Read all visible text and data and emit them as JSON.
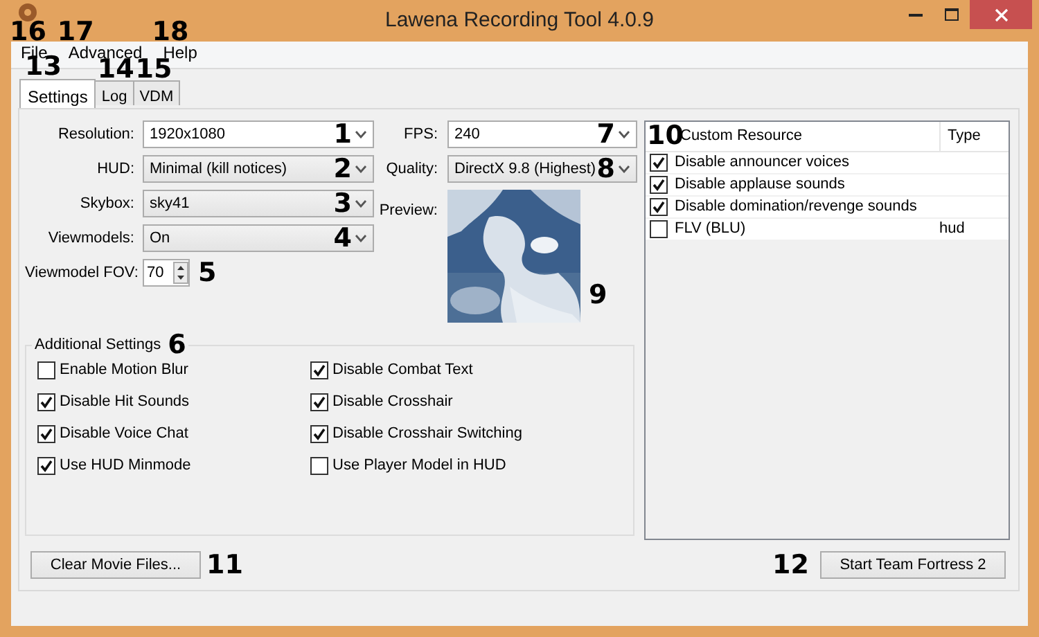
{
  "window": {
    "title": "Lawena Recording Tool 4.0.9"
  },
  "menu": [
    {
      "label": "File",
      "callout": "16"
    },
    {
      "label": "Advanced",
      "callout": "17"
    },
    {
      "label": "Help",
      "callout": "18"
    }
  ],
  "tabs": [
    {
      "label": "Settings",
      "selected": true,
      "callout": "13"
    },
    {
      "label": "Log",
      "selected": false,
      "callout": "14"
    },
    {
      "label": "VDM",
      "selected": false,
      "callout": "15"
    }
  ],
  "fields": [
    {
      "label": "Resolution:",
      "value": "1920x1080",
      "kind": "editable",
      "callout": "1"
    },
    {
      "label": "HUD:",
      "value": "Minimal (kill notices)",
      "kind": "dropdown",
      "callout": "2"
    },
    {
      "label": "Skybox:",
      "value": "sky41",
      "kind": "dropdown",
      "callout": "3"
    },
    {
      "label": "Viewmodels:",
      "value": "On",
      "kind": "dropdown",
      "callout": "4"
    },
    {
      "label": "Viewmodel FOV:",
      "value": "70",
      "kind": "spinner",
      "callout": "5"
    }
  ],
  "right_fields": [
    {
      "label": "FPS:",
      "value": "240",
      "kind": "editable",
      "callout": "7"
    },
    {
      "label": "Quality:",
      "value": "DirectX 9.8 (Highest)",
      "kind": "dropdown",
      "callout": "8"
    }
  ],
  "preview": {
    "label": "Preview:",
    "kind": "picture",
    "callout": "9"
  },
  "additional_settings": {
    "title": "Additional Settings",
    "callout": "6",
    "options": [
      {
        "label": "Enable Motion Blur",
        "checked": false
      },
      {
        "label": "Disable Combat Text",
        "checked": true
      },
      {
        "label": "Disable Hit Sounds",
        "checked": true
      },
      {
        "label": "Disable Crosshair",
        "checked": true
      },
      {
        "label": "Disable Voice Chat",
        "checked": true
      },
      {
        "label": "Disable Crosshair Switching",
        "checked": true
      },
      {
        "label": "Use HUD Minmode",
        "checked": true
      },
      {
        "label": "Use Player Model in HUD",
        "checked": false
      }
    ]
  },
  "custom_resources": {
    "callout": "10",
    "columns": [
      "Custom Resource",
      "Type"
    ],
    "rows": [
      {
        "name": "Disable announcer voices",
        "checked": true
      },
      {
        "name": "Disable applause sounds",
        "checked": true
      },
      {
        "name": "Disable domination/revenge sounds",
        "checked": true
      },
      {
        "name": "FLV (BLU)",
        "type": "hud",
        "checked": false
      }
    ]
  },
  "clear_button": {
    "label": "Clear Movie Files...",
    "callout": "11"
  },
  "start_button": {
    "label": "Start Team Fortress 2",
    "callout": "12"
  }
}
